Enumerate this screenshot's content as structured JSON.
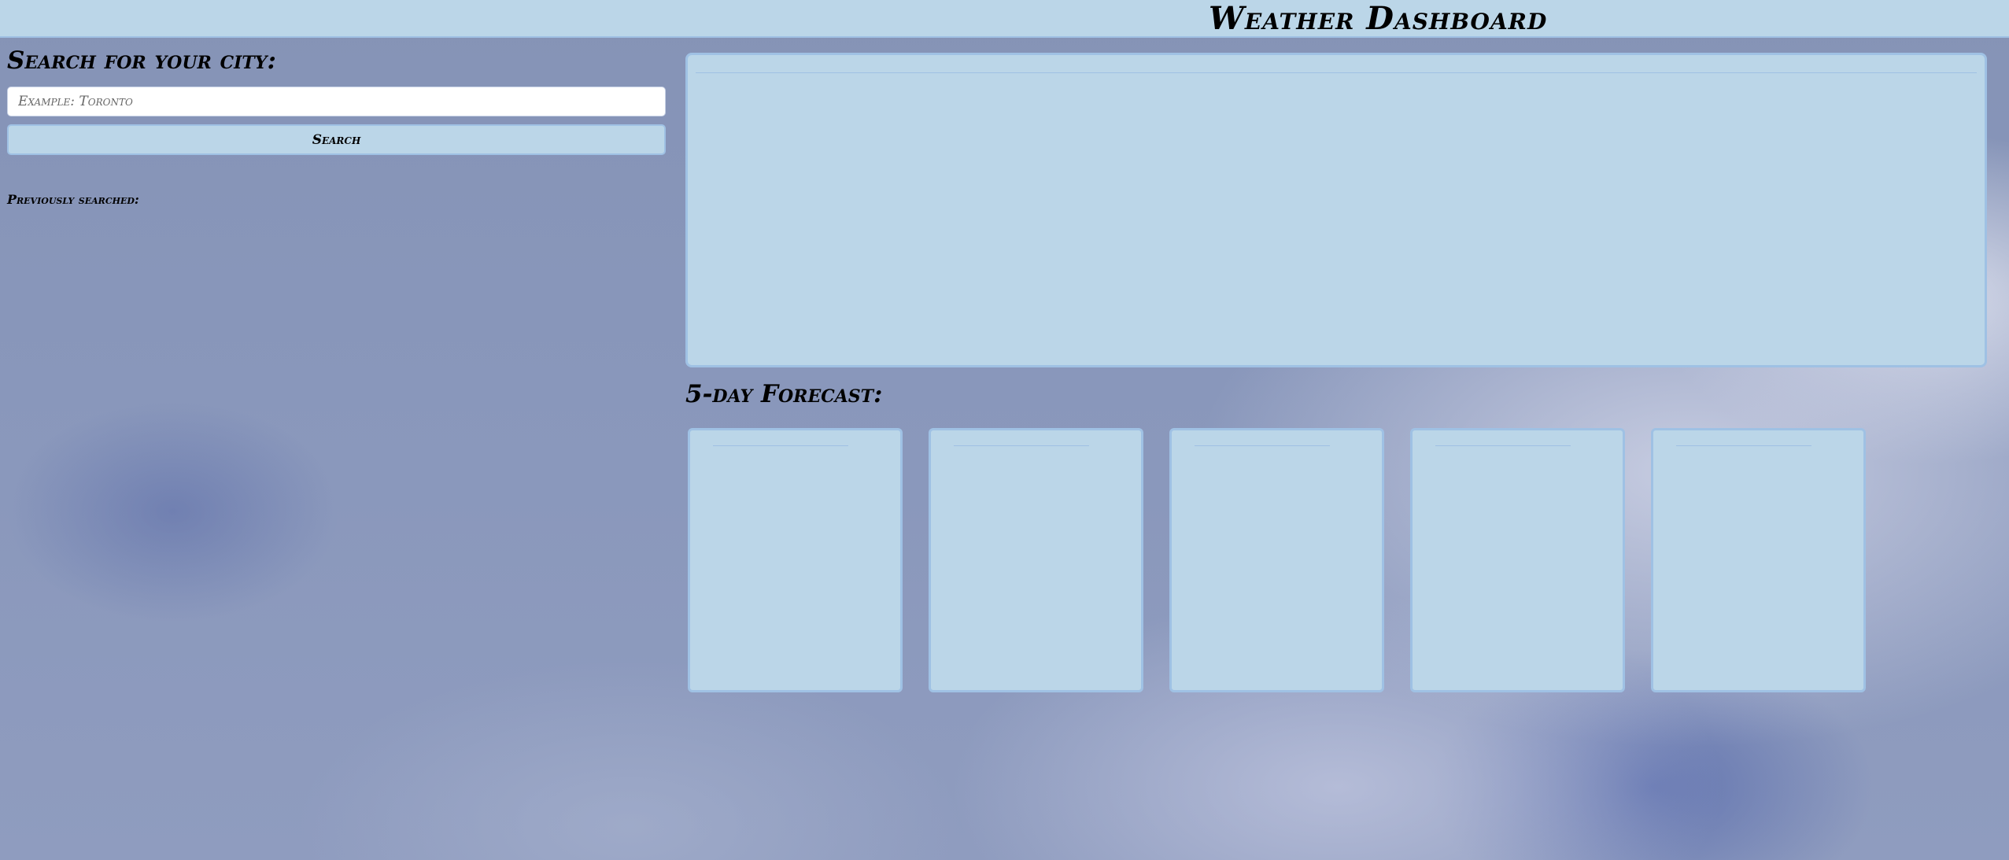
{
  "header": {
    "title": "Weather Dashboard"
  },
  "sidebar": {
    "heading": "Search for your city:",
    "search_placeholder": "Example: Toronto",
    "search_button_label": "Search",
    "history_label": "Previously searched:"
  },
  "forecast": {
    "heading": "5-day Forecast:"
  },
  "colors": {
    "panel_background": "#bbd6e8",
    "panel_border": "#9fc1e4",
    "page_background": "#8997bb"
  }
}
